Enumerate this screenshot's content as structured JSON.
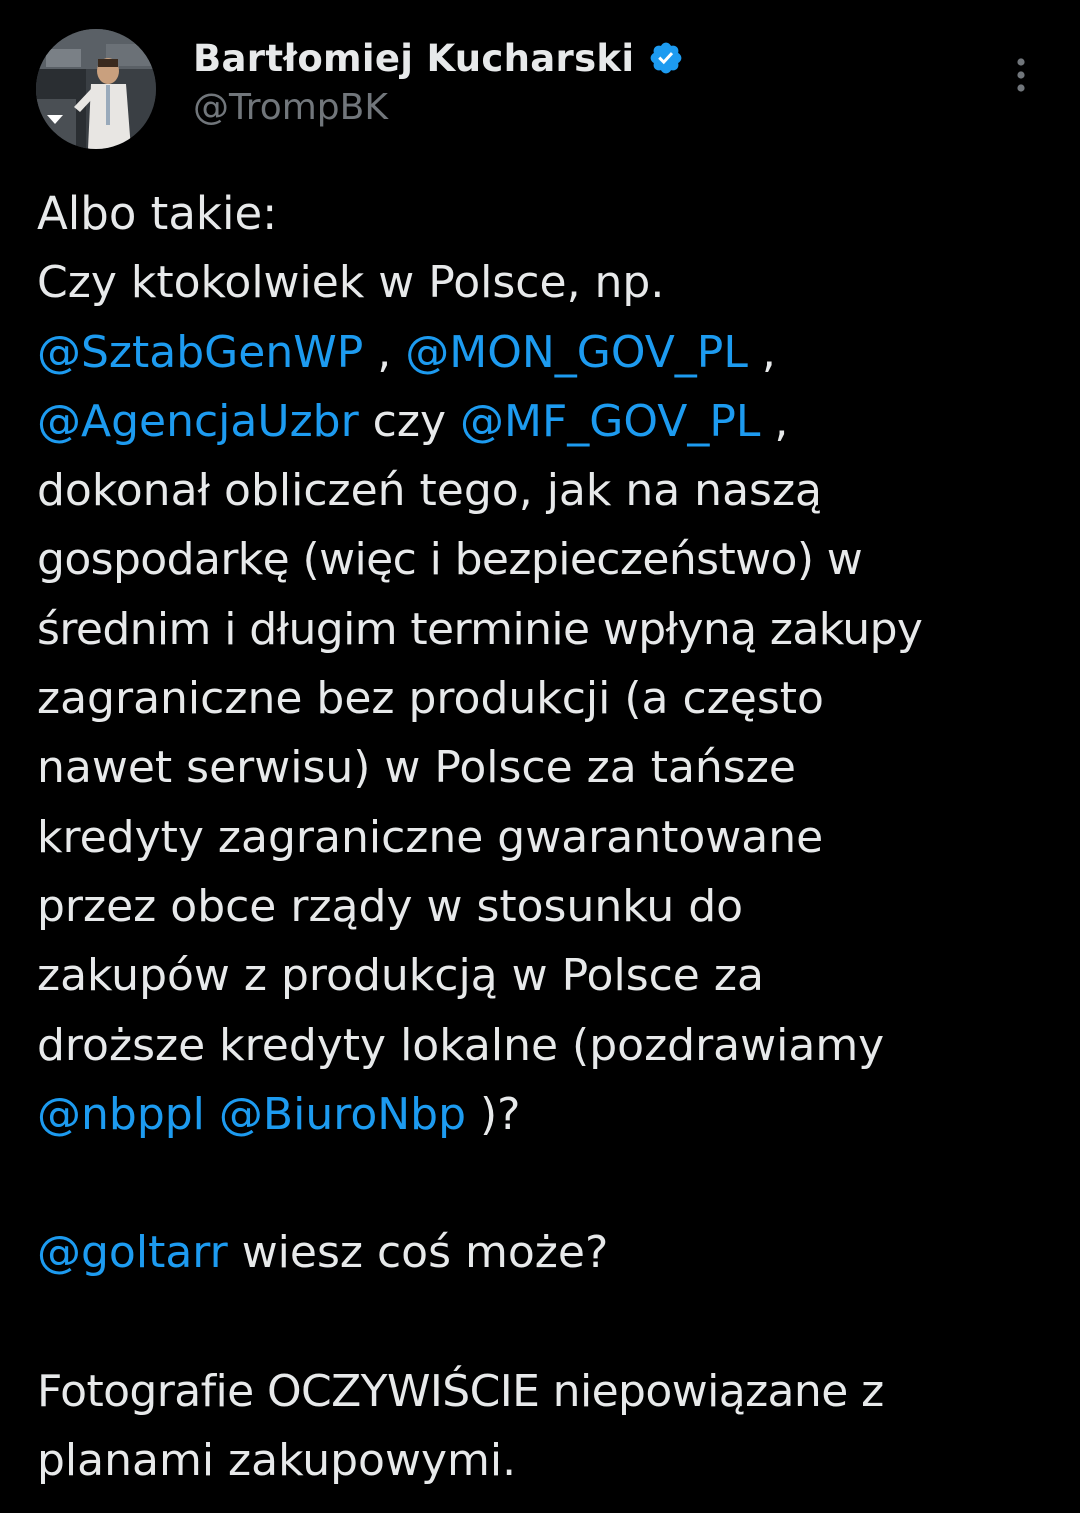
{
  "author": {
    "display_name": "Bartłomiej Kucharski",
    "handle": "@TrompBK",
    "verified": true,
    "verified_color": "#1d9bf0"
  },
  "icons": {
    "verified": "verified-badge-icon",
    "more": "more-vertical-icon",
    "avatar_badge": "chevron-down-icon"
  },
  "colors": {
    "background": "#000000",
    "text": "#e7e9ea",
    "secondary_text": "#71767b",
    "mention": "#1d9bf0"
  },
  "tweet": {
    "l1": "Albo takie:",
    "l2": "Czy ktokolwiek w Polsce, np.",
    "m_sztab": "@SztabGenWP",
    "sep1": " , ",
    "m_mon": "@MON_GOV_PL",
    "sep2": " ,",
    "m_agencja": "@AgencjaUzbr",
    "czy": " czy ",
    "m_mf": "@MF_GOV_PL",
    "sep3": " ,",
    "l5": "dokonał obliczeń tego, jak na naszą",
    "l6": "gospodarkę (więc i bezpieczeństwo) w",
    "l7": "średnim i długim terminie wpłyną zakupy",
    "l8": "zagraniczne bez produkcji (a często",
    "l9": "nawet serwisu) w Polsce za tańsze",
    "l10": "kredyty zagraniczne gwarantowane",
    "l11": "przez obce rządy w stosunku do",
    "l12": "zakupów z produkcją w Polsce za",
    "l13": "droższe kredyty lokalne (pozdrawiamy",
    "m_nbp": "@nbppl",
    "space": " ",
    "m_biuro": "@BiuroNbp",
    "end14": " )?",
    "m_goltarr": "@goltarr",
    "goltarr_text": " wiesz coś może?",
    "l18": "Fotografie OCZYWIŚCIE niepowiązane z",
    "l19": "planami zakupowymi."
  }
}
